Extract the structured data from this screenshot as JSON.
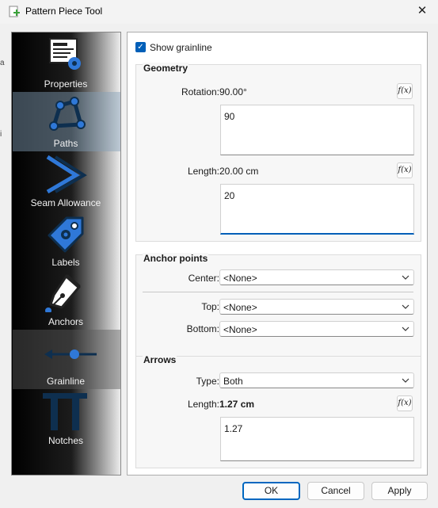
{
  "window": {
    "title": "Pattern Piece Tool",
    "close_symbol": "✕"
  },
  "left_edge_glyphs": [
    "a",
    "i"
  ],
  "sidebar": {
    "items": [
      {
        "label": "Properties",
        "icon": "properties-icon"
      },
      {
        "label": "Paths",
        "icon": "paths-icon",
        "state": "selected"
      },
      {
        "label": "Seam Allowance",
        "icon": "seam-allowance-icon"
      },
      {
        "label": "Labels",
        "icon": "labels-icon"
      },
      {
        "label": "Anchors",
        "icon": "anchors-icon"
      },
      {
        "label": "Grainline",
        "icon": "grainline-icon",
        "state": "active"
      },
      {
        "label": "Notches",
        "icon": "notches-icon"
      }
    ]
  },
  "grainline": {
    "show_grainline": {
      "label": "Show grainline",
      "checked": true,
      "check_symbol": "✓"
    },
    "geometry": {
      "title": "Geometry",
      "rotation": {
        "label": "Rotation:",
        "value": "90.00°",
        "formula": "90",
        "fx_label": "f(x)"
      },
      "length": {
        "label": "Length:",
        "value": "20.00 cm",
        "formula": "20",
        "fx_label": "f(x)"
      }
    },
    "anchor_points": {
      "title": "Anchor points",
      "center": {
        "label": "Center:",
        "value": "<None>"
      },
      "top": {
        "label": "Top:",
        "value": "<None>"
      },
      "bottom": {
        "label": "Bottom:",
        "value": "<None>"
      }
    },
    "arrows": {
      "title": "Arrows",
      "type": {
        "label": "Type:",
        "value": "Both"
      },
      "length": {
        "label": "Length:",
        "value": "1.27 cm",
        "formula": "1.27",
        "fx_label": "f(x)"
      }
    }
  },
  "buttons": {
    "ok": "OK",
    "cancel": "Cancel",
    "apply": "Apply"
  },
  "colors": {
    "accent": "#005fb8",
    "icon_blue": "#2f78d8",
    "icon_navy": "#0e2f4f"
  }
}
